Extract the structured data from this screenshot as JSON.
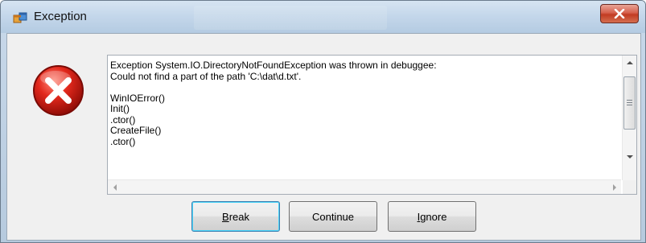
{
  "window": {
    "title": "Exception",
    "icon": "app-window-icon",
    "close_icon": "close-icon"
  },
  "error_icon": "error-x-icon",
  "message": {
    "lines": [
      "Exception System.IO.DirectoryNotFoundException was thrown in debuggee:",
      "Could not find a part of the path 'C:\\dat\\d.txt'.",
      "",
      "WinIOError()",
      "Init()",
      ".ctor()",
      "CreateFile()",
      ".ctor()"
    ]
  },
  "buttons": {
    "break": {
      "underline": "B",
      "rest": "reak"
    },
    "continue": {
      "label": "Continue"
    },
    "ignore": {
      "pre": "",
      "underline": "I",
      "rest": "gnore"
    }
  },
  "colors": {
    "close_red": "#c23b22",
    "error_red": "#d01818",
    "default_button_border": "#3c7fb1"
  }
}
